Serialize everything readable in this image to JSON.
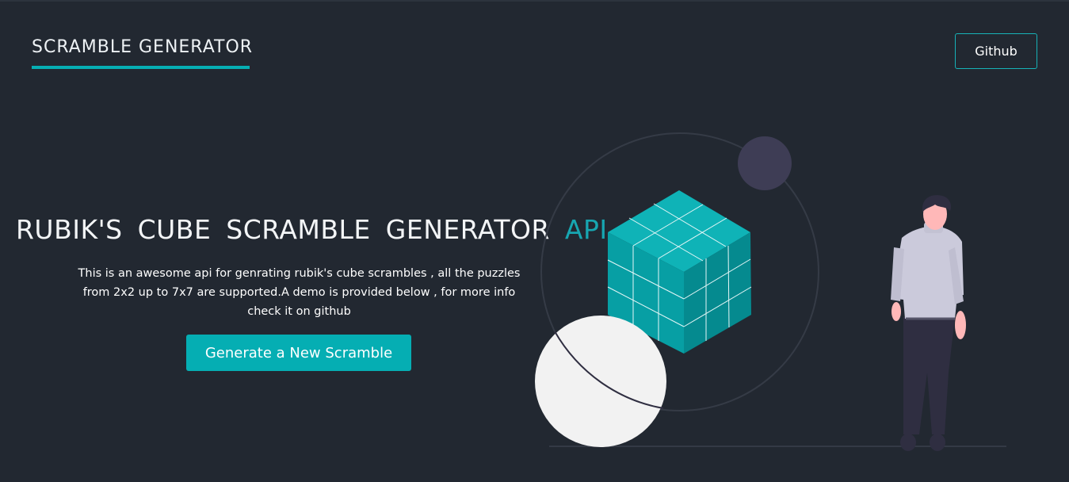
{
  "header": {
    "brand": "SCRAMBLE GENERATOR",
    "github_label": "Github"
  },
  "hero": {
    "title_main": "RUBIK'S  CUBE  SCRAMBLE  GENERATOR",
    "title_accent": "API",
    "description": "This is an awesome api for genrating rubik's cube scrambles , all the puzzles from 2x2 up to 7x7 are supported.A demo is provided below , for more info check it on github",
    "cta_label": "Generate a New Scramble"
  },
  "colors": {
    "background": "#222831",
    "accent": "#05aeb3",
    "title_accent": "#17a6b1"
  },
  "illustration": {
    "icons": [
      "rubiks-cube-icon",
      "person-icon",
      "sphere-icon",
      "planet-icon"
    ]
  }
}
